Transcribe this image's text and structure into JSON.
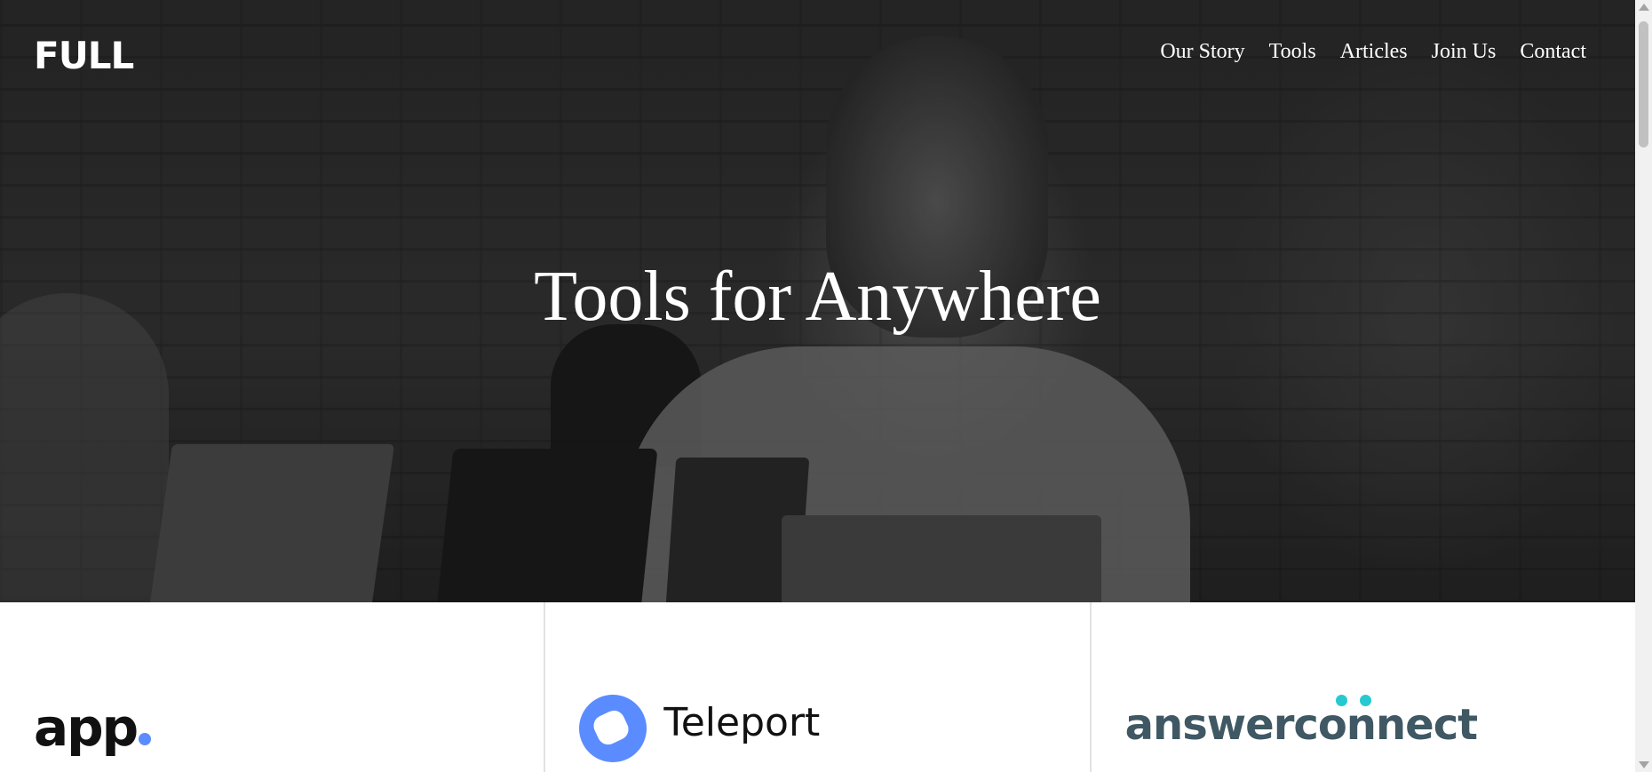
{
  "header": {
    "logo": "FULL",
    "nav": [
      "Our Story",
      "Tools",
      "Articles",
      "Join Us",
      "Contact"
    ]
  },
  "hero": {
    "title": "Tools for Anywhere"
  },
  "tools": [
    {
      "name": "app",
      "logo_colors": {
        "text": "#111111",
        "accent": "#5b8cff"
      }
    },
    {
      "name": "Teleport",
      "logo_colors": {
        "text": "#111111",
        "icon": "#5b8cff"
      }
    },
    {
      "name": "answerconnect",
      "logo_colors": {
        "text": "#3f5864",
        "accent": "#26c9cf"
      }
    }
  ],
  "icons": [
    "teleport-logo-icon",
    "scroll-up-arrow-icon",
    "scroll-down-arrow-icon"
  ]
}
